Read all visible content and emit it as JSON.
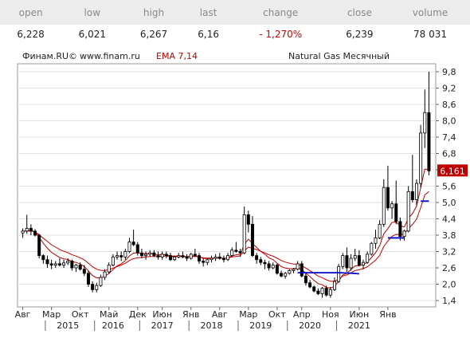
{
  "quote": {
    "headers": [
      "open",
      "low",
      "high",
      "last",
      "change",
      "close",
      "volume"
    ],
    "values": [
      "6,228",
      "6,021",
      "6,267",
      "6,16",
      "- 1,270%",
      "6,239",
      "78 031"
    ]
  },
  "chart_header": {
    "source": "Финам.RU©",
    "site": "www.finam.ru",
    "indicator": "EMA 7,14",
    "title": "Natural Gas Месячный"
  },
  "colors": {
    "up_candle": "#ffffff",
    "down_candle": "#000000",
    "ema_fast": "#c00000",
    "ema_slow": "#c00000",
    "trendline": "#0000c8",
    "price_marker_bg": "#c00000",
    "grid": "#e2e2e2"
  },
  "chart_data": {
    "type": "candlestick",
    "title": "Natural Gas Месячный",
    "last_price_label": "6,161",
    "y_ticks": [
      "9,8",
      "9,2",
      "8,6",
      "8,0",
      "7,4",
      "6,8",
      "6,2",
      "5,6",
      "5,0",
      "4,4",
      "3,8",
      "3,2",
      "2,6",
      "2,0",
      "1,4"
    ],
    "ylim": [
      1.4,
      9.8
    ],
    "x_month_labels": [
      "Авг",
      "Мар",
      "Окт",
      "Май",
      "Дек",
      "Июн",
      "Янв",
      "Авг",
      "Мар",
      "Окт",
      "Апр",
      "Ноя",
      "Июн",
      "Янв"
    ],
    "x_year_labels": [
      "2015",
      "2016",
      "2017",
      "2018",
      "2019",
      "2020",
      "2021"
    ],
    "grid": true,
    "series": [
      {
        "type": "candlestick",
        "ohlc": [
          [
            3.88,
            4.05,
            3.7,
            3.95
          ],
          [
            3.95,
            4.55,
            3.85,
            4.05
          ],
          [
            4.05,
            4.2,
            3.8,
            3.95
          ],
          [
            3.95,
            4.02,
            3.75,
            3.8
          ],
          [
            3.8,
            3.85,
            2.95,
            3.05
          ],
          [
            3.05,
            3.1,
            2.75,
            2.9
          ],
          [
            2.9,
            3.05,
            2.6,
            2.75
          ],
          [
            2.75,
            2.9,
            2.55,
            2.7
          ],
          [
            2.7,
            2.85,
            2.6,
            2.75
          ],
          [
            2.75,
            2.95,
            2.65,
            2.7
          ],
          [
            2.7,
            2.9,
            2.6,
            2.78
          ],
          [
            2.78,
            2.95,
            2.7,
            2.85
          ],
          [
            2.85,
            2.9,
            2.5,
            2.6
          ],
          [
            2.6,
            2.75,
            2.45,
            2.7
          ],
          [
            2.7,
            2.8,
            2.5,
            2.55
          ],
          [
            2.55,
            2.7,
            2.3,
            2.4
          ],
          [
            2.4,
            2.5,
            1.9,
            2.0
          ],
          [
            2.0,
            2.1,
            1.7,
            1.8
          ],
          [
            1.8,
            2.05,
            1.7,
            1.95
          ],
          [
            1.95,
            2.35,
            1.9,
            2.25
          ],
          [
            2.25,
            2.55,
            2.15,
            2.45
          ],
          [
            2.45,
            2.8,
            2.4,
            2.7
          ],
          [
            2.7,
            3.1,
            2.65,
            3.0
          ],
          [
            3.0,
            3.2,
            2.9,
            3.05
          ],
          [
            3.05,
            3.2,
            2.85,
            3.0
          ],
          [
            3.0,
            3.3,
            2.9,
            3.2
          ],
          [
            3.2,
            3.7,
            3.15,
            3.55
          ],
          [
            3.55,
            4.0,
            3.4,
            3.45
          ],
          [
            3.45,
            3.55,
            3.05,
            3.15
          ],
          [
            3.15,
            3.3,
            2.95,
            3.05
          ],
          [
            3.05,
            3.2,
            2.9,
            3.1
          ],
          [
            3.1,
            3.25,
            3.0,
            3.15
          ],
          [
            3.15,
            3.25,
            3.0,
            3.05
          ],
          [
            3.05,
            3.2,
            2.9,
            3.0
          ],
          [
            3.0,
            3.2,
            2.9,
            3.1
          ],
          [
            3.1,
            3.2,
            2.95,
            3.05
          ],
          [
            3.05,
            3.15,
            2.85,
            2.9
          ],
          [
            2.9,
            3.05,
            2.85,
            3.0
          ],
          [
            3.0,
            3.15,
            2.95,
            3.05
          ],
          [
            3.05,
            3.2,
            2.95,
            3.0
          ],
          [
            3.0,
            3.1,
            2.85,
            2.95
          ],
          [
            2.95,
            3.15,
            2.9,
            3.1
          ],
          [
            3.1,
            3.3,
            3.0,
            3.05
          ],
          [
            3.05,
            3.15,
            2.75,
            2.85
          ],
          [
            2.85,
            2.95,
            2.65,
            2.8
          ],
          [
            2.8,
            2.95,
            2.7,
            2.9
          ],
          [
            2.9,
            3.05,
            2.8,
            2.95
          ],
          [
            2.95,
            3.1,
            2.85,
            3.0
          ],
          [
            3.0,
            3.15,
            2.9,
            2.95
          ],
          [
            2.95,
            3.05,
            2.8,
            2.9
          ],
          [
            2.9,
            3.15,
            2.85,
            3.05
          ],
          [
            3.05,
            3.35,
            3.0,
            3.25
          ],
          [
            3.25,
            3.55,
            3.15,
            3.2
          ],
          [
            3.2,
            3.3,
            3.0,
            3.15
          ],
          [
            3.15,
            4.85,
            3.1,
            4.55
          ],
          [
            4.55,
            4.7,
            3.9,
            4.2
          ],
          [
            4.2,
            4.5,
            3.0,
            3.05
          ],
          [
            3.05,
            3.15,
            2.75,
            2.9
          ],
          [
            2.9,
            3.0,
            2.7,
            2.8
          ],
          [
            2.8,
            2.9,
            2.55,
            2.75
          ],
          [
            2.75,
            2.85,
            2.5,
            2.6
          ],
          [
            2.6,
            2.8,
            2.55,
            2.7
          ],
          [
            2.7,
            2.75,
            2.35,
            2.4
          ],
          [
            2.4,
            2.5,
            2.25,
            2.3
          ],
          [
            2.3,
            2.45,
            2.2,
            2.4
          ],
          [
            2.4,
            2.55,
            2.35,
            2.5
          ],
          [
            2.5,
            2.6,
            2.4,
            2.55
          ],
          [
            2.55,
            2.85,
            2.5,
            2.75
          ],
          [
            2.75,
            2.85,
            2.25,
            2.3
          ],
          [
            2.3,
            2.4,
            1.95,
            2.05
          ],
          [
            2.05,
            2.15,
            1.85,
            1.9
          ],
          [
            1.9,
            1.95,
            1.7,
            1.75
          ],
          [
            1.75,
            1.85,
            1.6,
            1.65
          ],
          [
            1.65,
            1.9,
            1.5,
            1.85
          ],
          [
            1.85,
            1.95,
            1.55,
            1.6
          ],
          [
            1.6,
            1.9,
            1.5,
            1.8
          ],
          [
            1.8,
            2.25,
            1.75,
            2.1
          ],
          [
            2.1,
            2.75,
            2.05,
            2.65
          ],
          [
            2.65,
            3.15,
            2.55,
            3.05
          ],
          [
            3.05,
            3.35,
            2.45,
            2.6
          ],
          [
            2.6,
            3.1,
            2.5,
            2.95
          ],
          [
            2.95,
            3.3,
            2.85,
            3.05
          ],
          [
            3.05,
            3.25,
            2.65,
            2.7
          ],
          [
            2.7,
            2.9,
            2.55,
            2.8
          ],
          [
            2.8,
            3.2,
            2.75,
            3.1
          ],
          [
            3.1,
            3.55,
            3.05,
            3.5
          ],
          [
            3.5,
            4.0,
            3.3,
            3.7
          ],
          [
            3.7,
            4.35,
            3.65,
            4.2
          ],
          [
            4.2,
            5.85,
            4.1,
            5.55
          ],
          [
            5.55,
            6.35,
            4.7,
            4.8
          ],
          [
            4.8,
            5.05,
            4.4,
            4.95
          ],
          [
            4.95,
            5.8,
            4.2,
            4.3
          ],
          [
            4.3,
            4.45,
            3.6,
            3.75
          ],
          [
            3.75,
            4.0,
            3.6,
            3.95
          ],
          [
            3.95,
            5.6,
            3.9,
            5.4
          ],
          [
            5.4,
            6.75,
            5.0,
            5.1
          ],
          [
            5.1,
            5.85,
            4.9,
            5.7
          ],
          [
            5.7,
            7.85,
            5.55,
            7.55
          ],
          [
            7.55,
            9.15,
            7.0,
            8.3
          ],
          [
            8.3,
            9.8,
            6.0,
            6.16
          ]
        ]
      },
      {
        "type": "line",
        "name": "EMA 7",
        "values": [
          3.94,
          3.97,
          3.97,
          3.93,
          3.71,
          3.51,
          3.32,
          3.17,
          3.07,
          2.98,
          2.93,
          2.91,
          2.83,
          2.8,
          2.74,
          2.65,
          2.49,
          2.32,
          2.23,
          2.23,
          2.29,
          2.39,
          2.54,
          2.67,
          2.75,
          2.87,
          3.04,
          3.14,
          3.15,
          3.13,
          3.12,
          3.13,
          3.11,
          3.08,
          3.09,
          3.08,
          3.04,
          3.03,
          3.04,
          3.03,
          3.01,
          3.03,
          3.04,
          3.0,
          2.95,
          2.94,
          2.94,
          2.96,
          2.96,
          2.94,
          2.97,
          3.04,
          3.08,
          3.1,
          3.46,
          3.65,
          3.5,
          3.35,
          3.21,
          3.1,
          2.97,
          2.9,
          2.77,
          2.65,
          2.59,
          2.57,
          2.56,
          2.61,
          2.53,
          2.41,
          2.28,
          2.14,
          2.02,
          1.98,
          1.88,
          1.86,
          1.92,
          2.11,
          2.34,
          2.4,
          2.54,
          2.67,
          2.68,
          2.71,
          2.81,
          2.98,
          3.16,
          3.42,
          3.85,
          4.04,
          4.27,
          4.28,
          4.15,
          4.1,
          4.42,
          4.59,
          4.87,
          5.54,
          6.23,
          6.21
        ]
      },
      {
        "type": "line",
        "name": "EMA 14",
        "values": [
          3.94,
          3.95,
          3.95,
          3.93,
          3.81,
          3.69,
          3.57,
          3.45,
          3.36,
          3.27,
          3.21,
          3.16,
          3.08,
          3.03,
          2.97,
          2.89,
          2.77,
          2.64,
          2.55,
          2.51,
          2.5,
          2.53,
          2.59,
          2.65,
          2.7,
          2.77,
          2.87,
          2.94,
          2.97,
          2.98,
          3.0,
          3.02,
          3.02,
          3.02,
          3.03,
          3.03,
          3.01,
          3.01,
          3.02,
          3.02,
          3.01,
          3.02,
          3.02,
          3.0,
          2.97,
          2.96,
          2.96,
          2.96,
          2.96,
          2.95,
          2.96,
          3.0,
          3.02,
          3.04,
          3.23,
          3.36,
          3.32,
          3.27,
          3.21,
          3.15,
          3.08,
          3.03,
          2.95,
          2.87,
          2.81,
          2.77,
          2.74,
          2.74,
          2.68,
          2.59,
          2.5,
          2.4,
          2.3,
          2.24,
          2.16,
          2.11,
          2.11,
          2.18,
          2.3,
          2.34,
          2.42,
          2.5,
          2.53,
          2.57,
          2.64,
          2.76,
          2.88,
          3.06,
          3.39,
          3.58,
          3.76,
          3.83,
          3.82,
          3.84,
          4.05,
          4.19,
          4.39,
          4.81,
          5.28,
          5.4
        ]
      }
    ],
    "trendlines": [
      {
        "name": "low-2020",
        "from": [
          67,
          2.42
        ],
        "to": [
          77,
          2.42
        ],
        "curve_end": [
          82,
          2.38
        ]
      },
      {
        "name": "low-2021",
        "from": [
          89,
          3.7
        ],
        "to": [
          93,
          3.7
        ]
      },
      {
        "name": "current",
        "from": [
          97,
          5.05
        ],
        "to": [
          99,
          5.05
        ]
      }
    ]
  }
}
